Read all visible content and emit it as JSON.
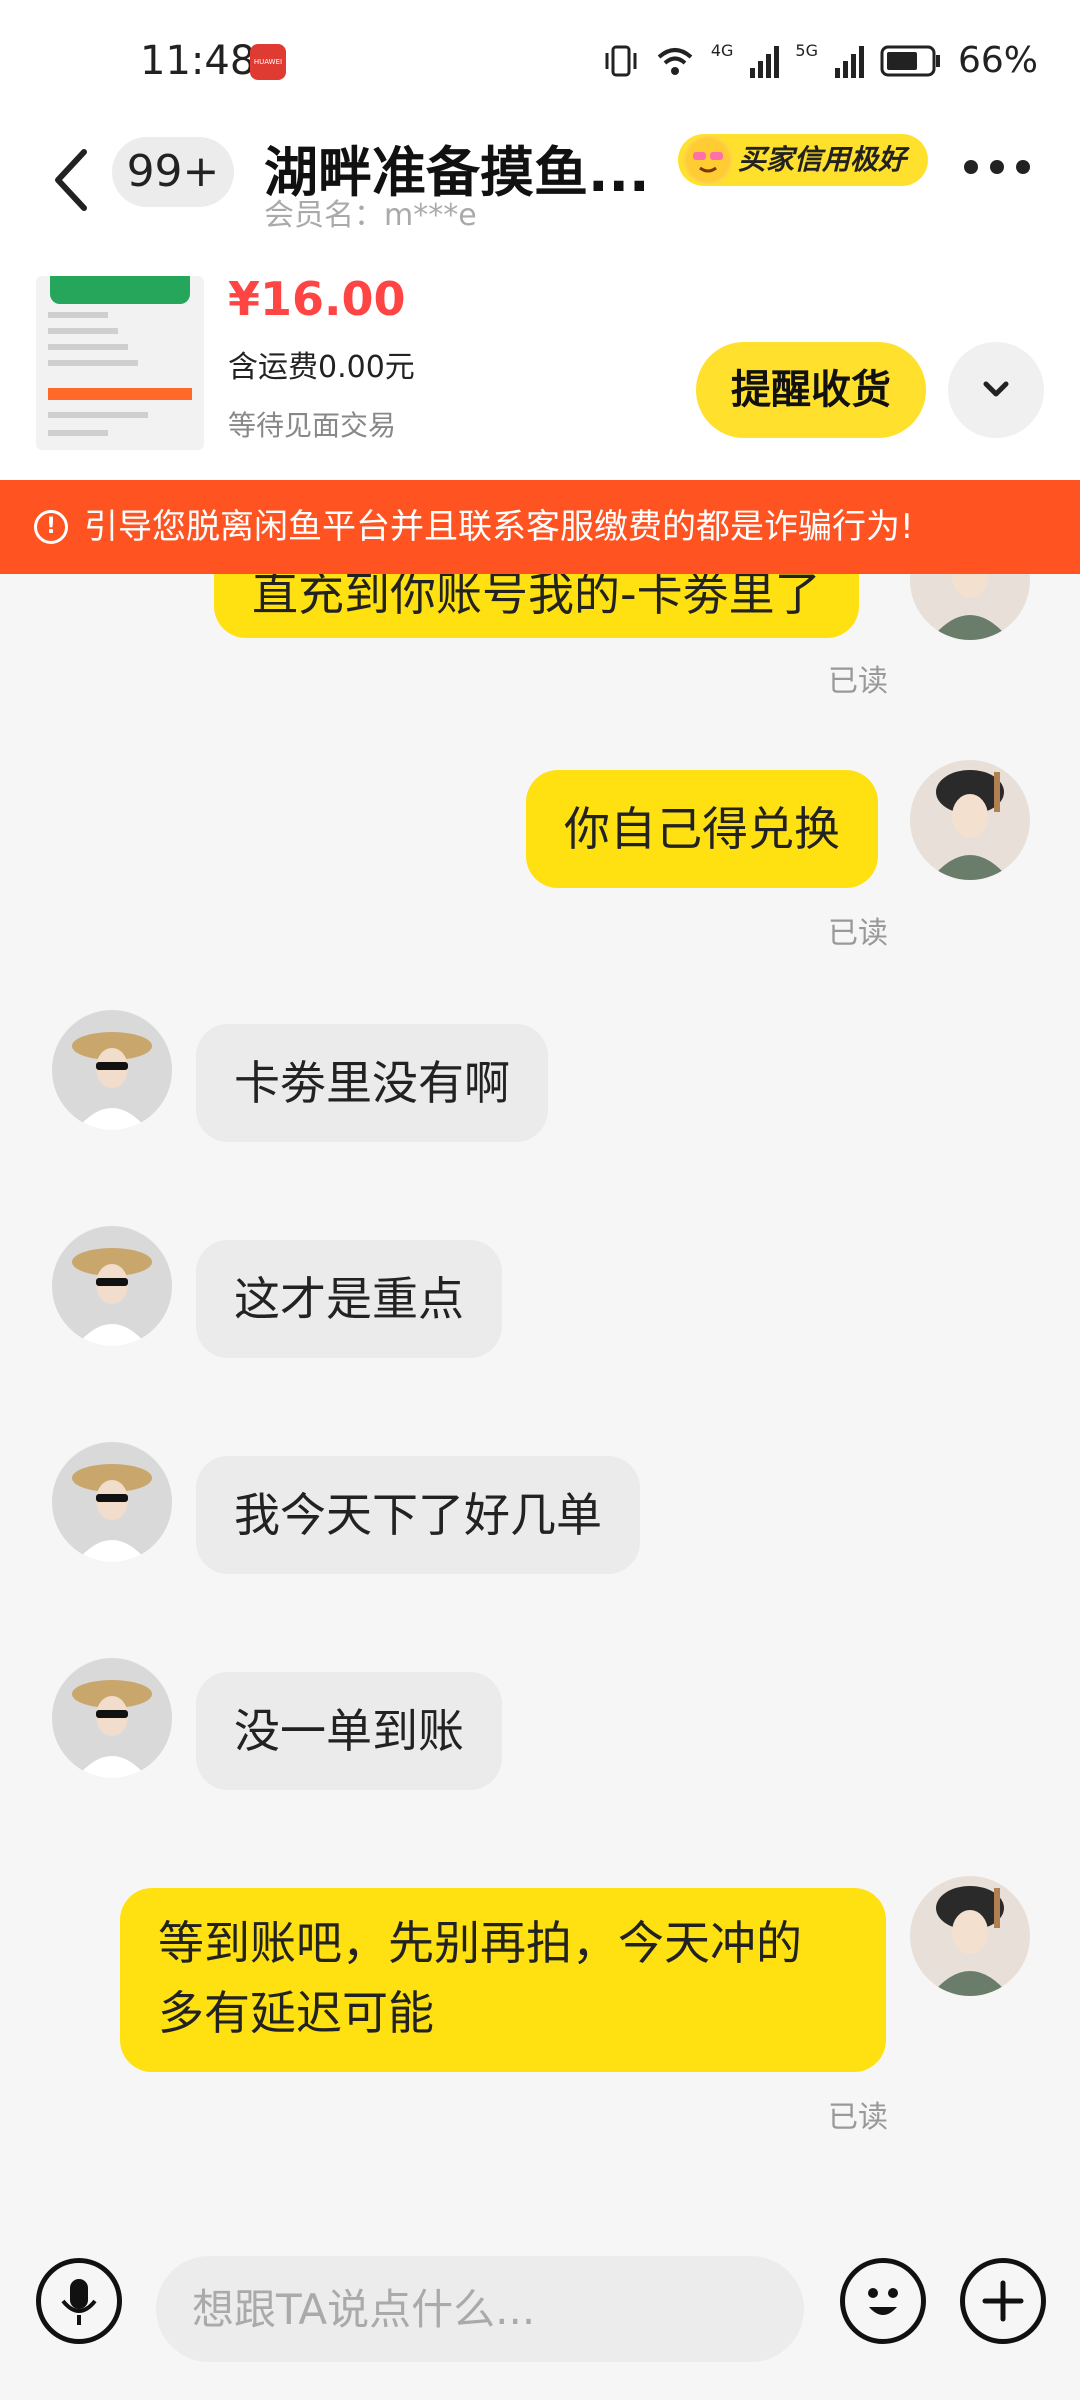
{
  "status_bar": {
    "time": "11:48",
    "app_badge": "HUAWEI",
    "battery": "66%",
    "net1": "4G",
    "net2": "5G"
  },
  "header": {
    "count": "99+",
    "title": "湖畔准备摸鱼...",
    "member": "会员名：m***e",
    "credit_badge": "买家信用极好"
  },
  "order": {
    "price": "¥16.00",
    "shipping": "含运费0.00元",
    "state": "等待见面交易",
    "remind_label": "提醒收货"
  },
  "warning": "引导您脱离闲鱼平台并且联系客服缴费的都是诈骗行为!",
  "messages": [
    {
      "text": "直充到你账号我的-卡劵里了",
      "from": "me",
      "read": "已读"
    },
    {
      "text": "你自己得兑换",
      "from": "me",
      "read": "已读"
    },
    {
      "text": "卡劵里没有啊",
      "from": "them"
    },
    {
      "text": "这才是重点",
      "from": "them"
    },
    {
      "text": "我今天下了好几单",
      "from": "them"
    },
    {
      "text": "没一单到账",
      "from": "them"
    },
    {
      "text_line1": "等到账吧，先别再拍，今天冲的",
      "text_line2": "多有延迟可能",
      "from": "me",
      "read": "已读"
    }
  ],
  "input": {
    "placeholder": "想跟TA说点什么..."
  },
  "icons": {
    "back": "chevron-left-icon",
    "more": "more-dots-icon",
    "expand": "chevron-down-icon",
    "mic": "microphone-icon",
    "emoji": "smiley-icon",
    "plus": "plus-icon"
  },
  "colors": {
    "accent_yellow": "#ffe111",
    "warning": "#ff5422",
    "price": "#ff4444"
  }
}
